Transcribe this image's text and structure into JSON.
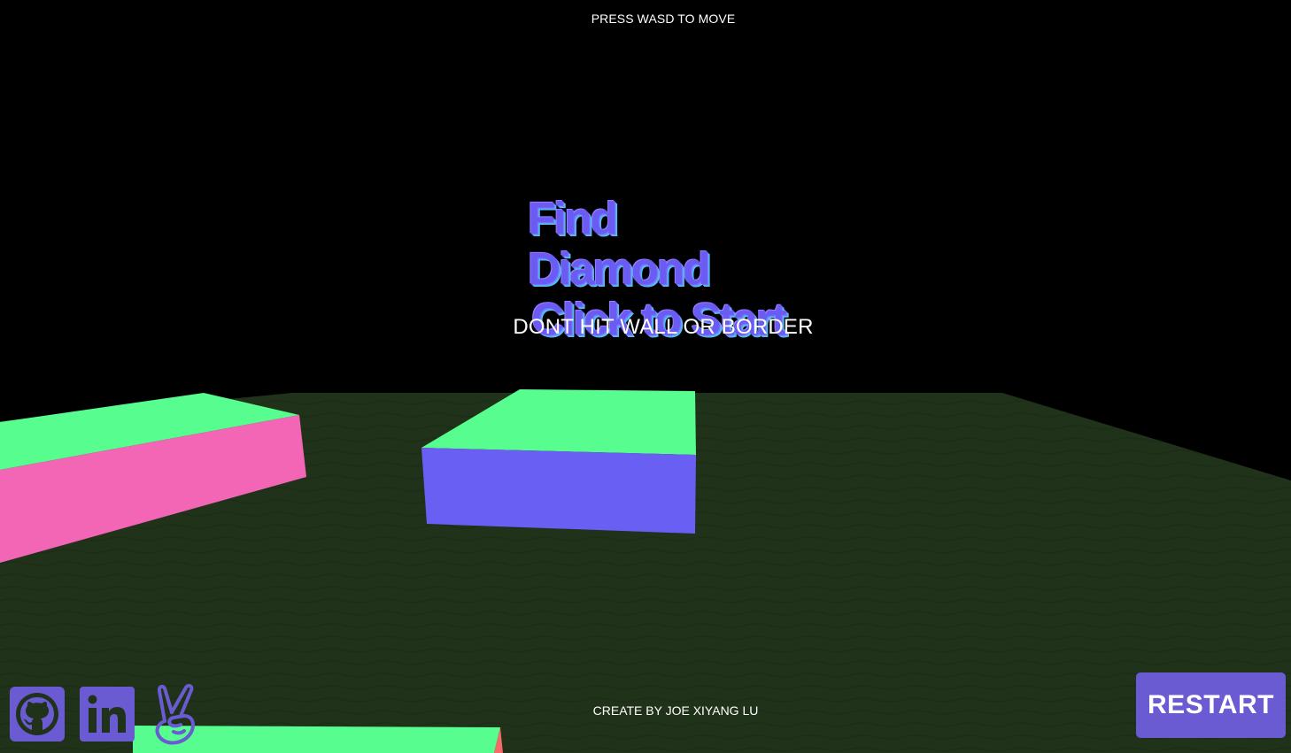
{
  "hud": {
    "controls_hint": "PRESS WASD TO MOVE",
    "title_line_1": "Find Diamond",
    "title_line_2": "Click to Start",
    "warning": "DONT HIT WALL OR BORDER",
    "credit": "CREATE BY JOE XIYANG LU",
    "restart_label": "RESTART"
  },
  "social_links": [
    {
      "icon": "github-icon"
    },
    {
      "icon": "linkedin-icon"
    },
    {
      "icon": "peace-hand-icon"
    }
  ],
  "colors": {
    "background": "#000000",
    "ground": "#20321a",
    "block_top": "#57fd8e",
    "block_side_pink": "#f266b5",
    "block_side_purple": "#6a5ff3",
    "block_side_salmon": "#f66a6a",
    "accent": "#6a5bd3"
  }
}
